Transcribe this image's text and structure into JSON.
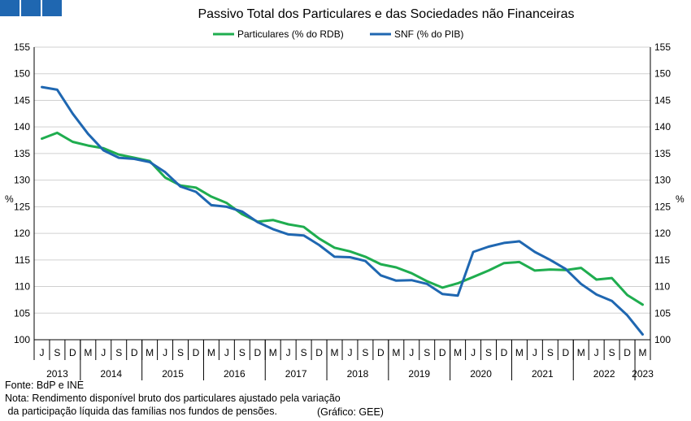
{
  "logo": {
    "squares": 3,
    "color": "#1f67b1"
  },
  "footer": {
    "source": "Fonte: BdP e INE",
    "note_line1": "Nota: Rendimento disponível bruto dos particulares ajustado pela variação",
    "note_line2": " da participação líquida das famílias nos fundos de pensões.",
    "credit": "(Gráfico: GEE)"
  },
  "chart_data": {
    "type": "line",
    "title": "Passivo Total dos Particulares e das Sociedades não Financeiras",
    "ylabel_left": "%",
    "ylabel_right": "%",
    "ylim": [
      100,
      155
    ],
    "yticks": [
      100,
      105,
      110,
      115,
      120,
      125,
      130,
      135,
      140,
      145,
      150,
      155
    ],
    "grid": "horizontal",
    "legend_position": "top-center",
    "quarter_labels": [
      "J",
      "S",
      "D",
      "M",
      "J",
      "S",
      "D",
      "M",
      "J",
      "S",
      "D",
      "M",
      "J",
      "S",
      "D",
      "M",
      "J",
      "S",
      "D",
      "M",
      "J",
      "S",
      "D",
      "M",
      "J",
      "S",
      "D",
      "M",
      "J",
      "S",
      "D",
      "M",
      "J",
      "S",
      "D",
      "M",
      "J",
      "S",
      "D",
      "M"
    ],
    "years": [
      {
        "label": "2013",
        "span": 3
      },
      {
        "label": "2014",
        "span": 4
      },
      {
        "label": "2015",
        "span": 4
      },
      {
        "label": "2016",
        "span": 4
      },
      {
        "label": "2017",
        "span": 4
      },
      {
        "label": "2018",
        "span": 4
      },
      {
        "label": "2019",
        "span": 4
      },
      {
        "label": "2020",
        "span": 4
      },
      {
        "label": "2021",
        "span": 4
      },
      {
        "label": "2022",
        "span": 4
      },
      {
        "label": "2023",
        "span": 1
      }
    ],
    "series": [
      {
        "name": "Particulares (% do RDB)",
        "color": "#1fad4f",
        "values": [
          137.8,
          138.9,
          137.2,
          136.5,
          136.0,
          134.8,
          134.2,
          133.6,
          130.5,
          129.0,
          128.6,
          126.9,
          125.7,
          123.6,
          122.2,
          122.5,
          121.7,
          121.2,
          119.0,
          117.3,
          116.6,
          115.6,
          114.2,
          113.6,
          112.5,
          111.0,
          109.8,
          110.6,
          111.8,
          113.0,
          114.4,
          114.6,
          113.0,
          113.2,
          113.1,
          113.5,
          111.3,
          111.6,
          108.4,
          106.6
        ]
      },
      {
        "name": "SNF (% do PIB)",
        "color": "#1f67b1",
        "values": [
          147.5,
          147.0,
          142.5,
          138.7,
          135.6,
          134.2,
          134.0,
          133.4,
          131.5,
          128.8,
          127.8,
          125.3,
          125.0,
          124.1,
          122.1,
          120.8,
          119.8,
          119.6,
          117.8,
          115.6,
          115.5,
          114.8,
          112.1,
          111.1,
          111.2,
          110.5,
          108.6,
          108.3,
          116.5,
          117.5,
          118.2,
          118.5,
          116.5,
          115.0,
          113.3,
          110.5,
          108.5,
          107.3,
          104.6,
          101.0
        ]
      }
    ]
  }
}
